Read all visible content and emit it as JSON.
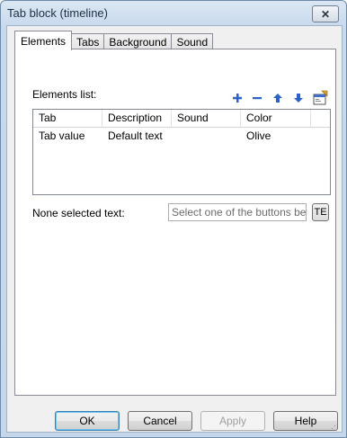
{
  "window": {
    "title": "Tab block (timeline)",
    "close_glyph": "✕"
  },
  "tabs": [
    {
      "label": "Elements",
      "active": true
    },
    {
      "label": "Tabs",
      "active": false
    },
    {
      "label": "Background",
      "active": false
    },
    {
      "label": "Sound",
      "active": false
    }
  ],
  "elements": {
    "label": "Elements list:",
    "toolbar": {
      "add_icon": "plus-icon",
      "remove_icon": "minus-icon",
      "up_icon": "arrow-up-icon",
      "down_icon": "arrow-down-icon",
      "properties_icon": "properties-icon"
    },
    "columns": [
      "Tab",
      "Description",
      "Sound",
      "Color"
    ],
    "rows": [
      [
        "Tab value",
        "Default text",
        "",
        "Olive"
      ]
    ]
  },
  "none_selected": {
    "label": "None selected text:",
    "placeholder": "Select one of the buttons below",
    "te_label": "TE"
  },
  "buttons": {
    "ok": "OK",
    "cancel": "Cancel",
    "apply": "Apply",
    "help": "Help"
  },
  "colors": {
    "accent": "#2a62c9",
    "title_bar": "#c7d9ec"
  }
}
